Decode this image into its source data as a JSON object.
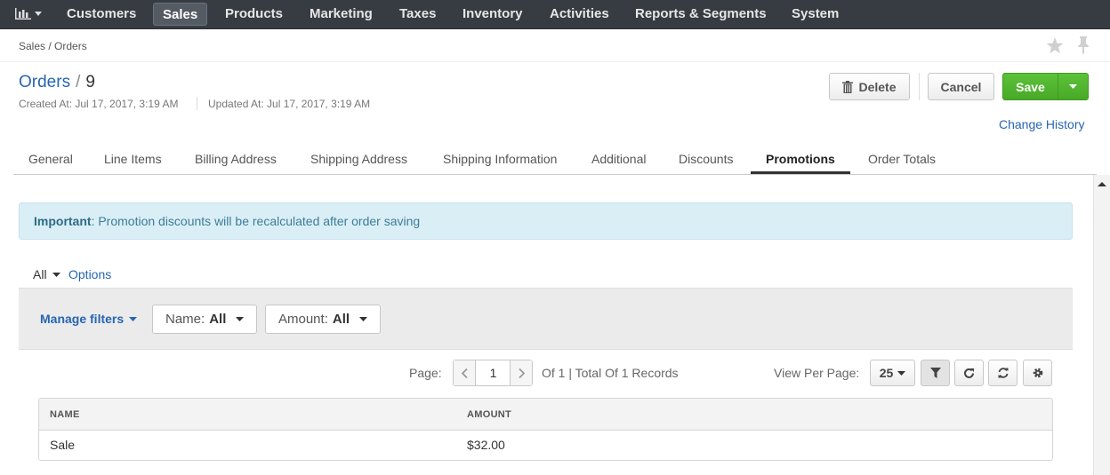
{
  "nav": {
    "items": [
      "Customers",
      "Sales",
      "Products",
      "Marketing",
      "Taxes",
      "Inventory",
      "Activities",
      "Reports & Segments",
      "System"
    ],
    "active": "Sales"
  },
  "breadcrumb": "Sales / Orders",
  "header": {
    "entity": "Orders",
    "separator": "/",
    "id": "9",
    "created": "Created At: Jul 17, 2017, 3:19 AM",
    "updated": "Updated At: Jul 17, 2017, 3:19 AM"
  },
  "actions": {
    "delete": "Delete",
    "cancel": "Cancel",
    "save": "Save",
    "change_history": "Change History"
  },
  "tabs": [
    "General",
    "Line Items",
    "Billing Address",
    "Shipping Address",
    "Shipping Information",
    "Additional",
    "Discounts",
    "Promotions",
    "Order Totals"
  ],
  "active_tab": "Promotions",
  "alert": {
    "strong": "Important",
    "text": ": Promotion discounts will be recalculated after order saving"
  },
  "grid": {
    "view": "All",
    "options": "Options",
    "manage_filters": "Manage filters",
    "filters": [
      {
        "label": "Name:",
        "value": "All"
      },
      {
        "label": "Amount:",
        "value": "All"
      }
    ],
    "pager": {
      "label": "Page:",
      "page": "1",
      "total": "Of 1 | Total Of 1 Records"
    },
    "view_per_page": {
      "label": "View Per Page:",
      "value": "25"
    },
    "columns": [
      "NAME",
      "AMOUNT"
    ],
    "rows": [
      [
        "Sale",
        "$32.00"
      ]
    ]
  },
  "icons": [
    "bar-chart-icon",
    "star-icon",
    "pin-icon",
    "trash-icon",
    "filter-icon",
    "refresh-icon",
    "reset-icon",
    "gear-icon"
  ],
  "colors": {
    "nav_bg": "#373c43",
    "link": "#2765b2",
    "save": "#4cae2a",
    "alert_bg": "#daeef6"
  }
}
